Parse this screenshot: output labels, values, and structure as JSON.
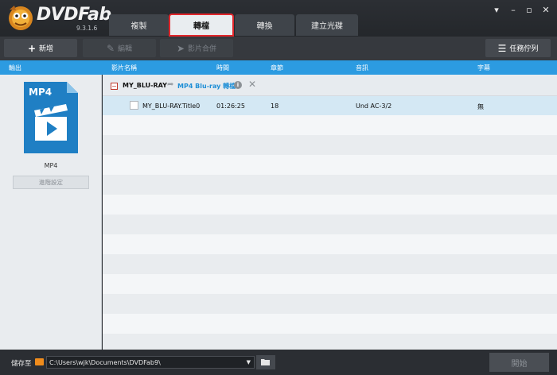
{
  "app": {
    "brand": "DVDFab",
    "version": "9.3.1.6"
  },
  "tabs": [
    {
      "label": "複製"
    },
    {
      "label": "轉檔"
    },
    {
      "label": "轉換"
    },
    {
      "label": "建立光碟"
    }
  ],
  "toolbar": {
    "add_label": "新增",
    "edit_label": "編輯",
    "merge_label": "影片合併",
    "queue_label": "任務佇列"
  },
  "header": {
    "output": "輸出",
    "title": "影片名稱",
    "time": "時間",
    "chapter": "章節",
    "audio": "音訊",
    "subtitle": "字幕"
  },
  "output_panel": {
    "format_icon_text": "MP4",
    "format_label": "MP4",
    "advanced_label": "進階設定"
  },
  "source": {
    "name": "MY_BLU-RAY",
    "target": "MP4 Blu-ray 轉檔"
  },
  "titles": [
    {
      "name": "MY_BLU-RAY.Title0",
      "time": "01:26:25",
      "chapters": "18",
      "audio": "Und AC-3/2",
      "subtitle": "無"
    }
  ],
  "bottom": {
    "save_label": "儲存至",
    "path": "C:\\Users\\wjk\\Documents\\DVDFab9\\",
    "start_label": "開始"
  },
  "colors": {
    "accent": "#2c9be1",
    "highlight_border": "#e2262b",
    "selected_row": "#d4e8f4"
  }
}
